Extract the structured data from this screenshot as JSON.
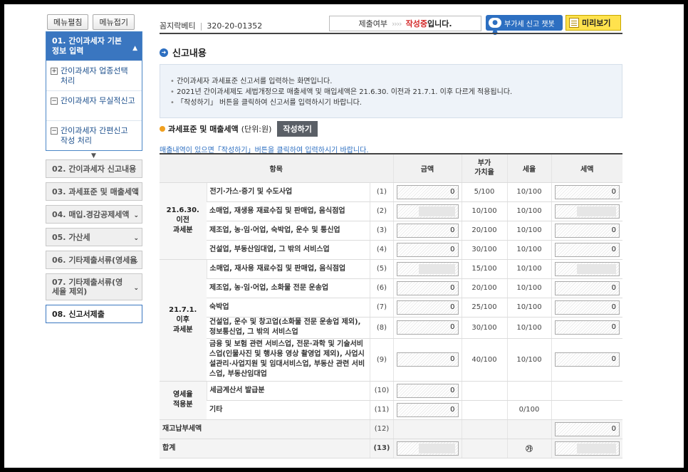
{
  "sidebar": {
    "edit_btn": "메뉴펼침",
    "collapse_btn": "메뉴접기",
    "section1": {
      "title": "01. 간이과세자 기본정보 입력",
      "items": [
        {
          "icon": "plus-box-icon",
          "mark": "+",
          "label": "간이과세자 업종선택 처리"
        },
        {
          "icon": "minus-box-icon",
          "mark": "−",
          "label": "간이과세자 무실적신고"
        },
        {
          "icon": "minus-box-icon",
          "mark": "−",
          "label": "간이과세자 간편신고 작성 처리"
        }
      ]
    },
    "menu": [
      {
        "label": "02. 간이과세자 신고내용"
      },
      {
        "label": "03. 과세표준 및 매출세액"
      },
      {
        "label": "04. 매입.경감공제세액"
      },
      {
        "label": "05. 가산세"
      },
      {
        "label": "06. 기타제출서류(영세율"
      },
      {
        "label": "07. 기타제출서류(영세율 제외)"
      },
      {
        "label": "08. 신고서제출"
      }
    ]
  },
  "header": {
    "biz_name": "꼼지락베티",
    "biz_no": "320-20-01352",
    "status_label": "제출여부",
    "status_arrows": "››››",
    "status_value": "작성중",
    "status_suffix": "입니다.",
    "chatbot_label": "부가세 신고 챗봇",
    "chatbot_icon": "chatbot-icon",
    "preview_label": "미리보기",
    "preview_icon": "document-icon"
  },
  "section": {
    "title": "신고내용",
    "info": [
      "간이과세자 과세표준 신고서를 입력하는 화면입니다.",
      "2021년 간이과세제도 세법개정으로 매출세액 및 매입세액은 21.6.30. 이전과 21.7.1. 이후 다르게 적용됩니다.",
      "「작성하기」 버튼을 클릭하여 신고서를 입력하시기 바랍니다."
    ],
    "sub_title": "과세표준 및 매출세액",
    "sub_unit": "(단위:원)",
    "write_btn": "작성하기",
    "note": "매출내역이 있으면「작성하기」버튼을 클릭하여 입력하시기 바랍니다."
  },
  "table": {
    "headers": [
      "항목",
      "금액",
      "부가\n가치율",
      "세율",
      "세액"
    ],
    "group1": "21.6.30.\n이전\n과세분",
    "group2": "21.7.1.\n이후\n과세분",
    "group3": "영세율\n적용분",
    "rows": [
      {
        "label": "전기·가스·증기 및 수도사업",
        "no": "(1)",
        "amount": "0",
        "vrate": "5/100",
        "trate": "10/100",
        "tax": "0"
      },
      {
        "label": "소매업, 재생용 재료수집 및 판매업, 음식점업",
        "no": "(2)",
        "amount": "",
        "vrate": "10/100",
        "trate": "10/100",
        "tax": ""
      },
      {
        "label": "제조업, 농·임·어업, 숙박업, 운수 및 통신업",
        "no": "(3)",
        "amount": "0",
        "vrate": "20/100",
        "trate": "10/100",
        "tax": "0"
      },
      {
        "label": "건설업, 부동산임대업, 그 밖의 서비스업",
        "no": "(4)",
        "amount": "0",
        "vrate": "30/100",
        "trate": "10/100",
        "tax": "0"
      },
      {
        "label": "소매업, 재사용 재료수집 및 판매업, 음식점업",
        "no": "(5)",
        "amount": "",
        "vrate": "15/100",
        "trate": "10/100",
        "tax": ""
      },
      {
        "label": "제조업, 농·임·어업, 소화물 전문 운송업",
        "no": "(6)",
        "amount": "0",
        "vrate": "20/100",
        "trate": "10/100",
        "tax": "0"
      },
      {
        "label": "숙박업",
        "no": "(7)",
        "amount": "0",
        "vrate": "25/100",
        "trate": "10/100",
        "tax": "0"
      },
      {
        "label": "건설업, 운수 및 창고업(소화물 전문 운송업 제외), 정보통신업, 그 밖의 서비스업",
        "no": "(8)",
        "amount": "0",
        "vrate": "30/100",
        "trate": "10/100",
        "tax": "0"
      },
      {
        "label": "금융 및 보험 관련 서비스업, 전문·과학 및 기술서비스업(인물사진 및 행사용 영상 촬영업 제외), 사업시설관리·사업지원 및 임대서비스업, 부동산 관련 서비스업, 부동산임대업",
        "no": "(9)",
        "amount": "0",
        "vrate": "40/100",
        "trate": "10/100",
        "tax": "0"
      },
      {
        "label": "세금계산서 발급분",
        "no": "(10)",
        "amount": "0",
        "vrate": "",
        "trate": "",
        "tax": ""
      },
      {
        "label": "기타",
        "no": "(11)",
        "amount": "0",
        "vrate": "",
        "trate": "0/100",
        "tax": ""
      }
    ],
    "stock_label": "재고납부세액",
    "stock_no": "(12)",
    "stock_tax": "0",
    "total_label": "합계",
    "total_no": "(13)",
    "total_mark": "㉮"
  }
}
